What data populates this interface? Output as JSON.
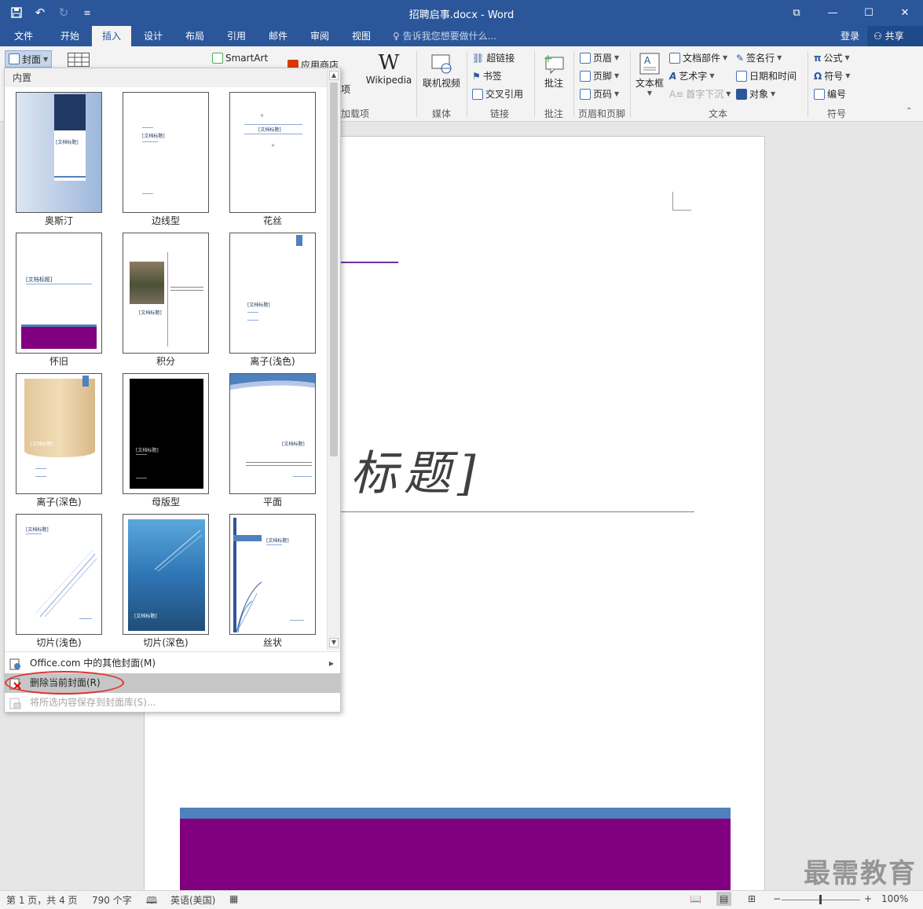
{
  "window": {
    "title": "招聘启事.docx - Word",
    "minimize": "—",
    "maximize": "☐",
    "close": "✕",
    "restore_icon": "⧉"
  },
  "qat": {
    "save": "💾",
    "undo": "↶",
    "redo": "↻",
    "customize": "≡"
  },
  "tabs": [
    {
      "label": "文件"
    },
    {
      "label": "开始"
    },
    {
      "label": "插入"
    },
    {
      "label": "设计"
    },
    {
      "label": "布局"
    },
    {
      "label": "引用"
    },
    {
      "label": "邮件"
    },
    {
      "label": "审阅"
    },
    {
      "label": "视图"
    }
  ],
  "tell_me": "告诉我您想要做什么...",
  "account": {
    "login": "登录",
    "share": "共享"
  },
  "ribbon": {
    "cover": "封面",
    "smartart": "SmartArt",
    "store": "应用商店",
    "addins_partial": "项",
    "addins_group_partial": "加载项",
    "wikipedia": "Wikipedia",
    "wikipedia_logo": "W",
    "online_video": "联机视频",
    "media_group": "媒体",
    "hyperlink": "超链接",
    "bookmark": "书签",
    "crossref": "交叉引用",
    "links_group": "链接",
    "comment": "批注",
    "comment_group": "批注",
    "header": "页眉",
    "footer": "页脚",
    "page_number": "页码",
    "hf_group": "页眉和页脚",
    "textbox": "文本框",
    "quick_parts": "文档部件",
    "wordart": "艺术字",
    "dropcap": "首字下沉",
    "signature": "签名行",
    "datetime": "日期和时间",
    "object": "对象",
    "text_group": "文本",
    "equation": "公式",
    "symbol": "符号",
    "number": "编号",
    "symbols_group": "符号"
  },
  "gallery": {
    "header": "内置",
    "items": [
      {
        "label": "奥斯汀"
      },
      {
        "label": "边线型"
      },
      {
        "label": "花丝"
      },
      {
        "label": "怀旧"
      },
      {
        "label": "积分"
      },
      {
        "label": "离子(浅色)"
      },
      {
        "label": "离子(深色)"
      },
      {
        "label": "母版型"
      },
      {
        "label": "平面"
      },
      {
        "label": "切片(浅色)"
      },
      {
        "label": "切片(深色)"
      },
      {
        "label": "丝状"
      }
    ],
    "thumb_text": "[文档标题]",
    "menu": {
      "more_covers": "Office.com 中的其他封面(M)",
      "remove_cover": "删除当前封面(R)",
      "save_selection": "将所选内容保存到封面库(S)..."
    }
  },
  "document": {
    "title_fragment": "标题]",
    "watermark": "最需教育"
  },
  "status": {
    "page": "第 1 页，共 4 页",
    "words": "790 个字",
    "language": "英语(美国)",
    "zoom": "100%",
    "zoom_minus": "−",
    "zoom_plus": "+"
  },
  "colors": {
    "ribbon_blue": "#2b579a",
    "purple": "#800080",
    "band_blue": "#4f81bd",
    "highlight_red": "#e03030"
  }
}
